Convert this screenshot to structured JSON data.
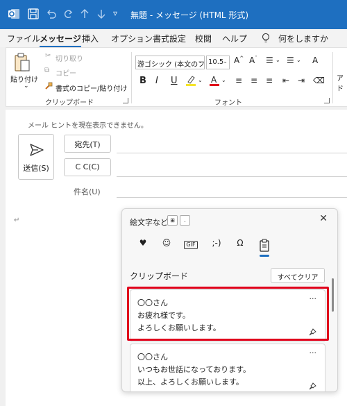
{
  "window": {
    "title": "無題  -  メッセージ (HTML 形式)",
    "accent": "#1e6fc0",
    "quick_access_more": "▿"
  },
  "ribbon_tabs": [
    {
      "label": "ファイル",
      "active": false
    },
    {
      "label": "メッセージ",
      "active": true
    },
    {
      "label": "挿入",
      "active": false
    },
    {
      "label": "オプション",
      "active": false
    },
    {
      "label": "書式設定",
      "active": false
    },
    {
      "label": "校閲",
      "active": false
    },
    {
      "label": "ヘルプ",
      "active": false
    }
  ],
  "tell_me": "何をしますか",
  "clipboard_group": {
    "paste": "貼り付け",
    "cut": "切り取り",
    "copy": "コピー",
    "format_painter": "書式のコピー/貼り付け",
    "label": "クリップボード"
  },
  "font_group": {
    "font_name": "游ゴシック (本文のフォ",
    "font_size": "10.5",
    "label": "フォント",
    "bold": "B",
    "italic": "I",
    "underline": "U",
    "highlight_color": "#f5e42a",
    "font_color": "#e0001b"
  },
  "cut_off_label": "アド",
  "compose": {
    "mailtip": "メール ヒントを現在表示できません。",
    "send": "送信(S)",
    "to": "宛先(T)",
    "cc": "C C(C)",
    "subject": "件名(U)",
    "body_mark": "↵"
  },
  "emoji_panel": {
    "title": "絵文字など",
    "key1": "⊞",
    "key2": ".",
    "close": "✕",
    "tabs": [
      "♥",
      "☺",
      "GIF",
      ";-)",
      "Ω",
      "📋"
    ],
    "clipboard_header": "クリップボード",
    "clear_all": "すべてクリア",
    "items": [
      {
        "lines": [
          "〇〇さん",
          "お疲れ様です。",
          "よろしくお願いします。"
        ],
        "more": "···"
      },
      {
        "lines": [
          "〇〇さん",
          "いつもお世話になっております。",
          "以上、よろしくお願いします。"
        ],
        "more": "···"
      }
    ],
    "highlight_color": "#e0001b"
  }
}
